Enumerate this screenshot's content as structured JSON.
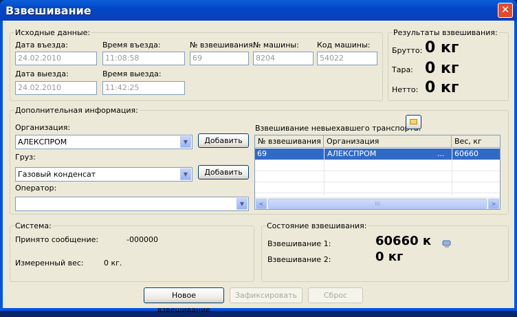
{
  "window": {
    "title": "Взвешивание",
    "close_glyph": "✕"
  },
  "source": {
    "legend": "Исходные данные:",
    "entry_date_label": "Дата въезда:",
    "entry_date": "24.02.2010",
    "entry_time_label": "Время въезда:",
    "entry_time": "11:08:58",
    "weighing_no_label": "№ взвешивания:",
    "weighing_no": "69",
    "car_no_label": "№ машины:",
    "car_no": "8204",
    "car_code_label": "Код машины:",
    "car_code": "54022",
    "exit_date_label": "Дата выезда:",
    "exit_date": "24.02.2010",
    "exit_time_label": "Время выезда:",
    "exit_time": "11:42:25"
  },
  "results": {
    "legend": "Результаты взвешивания:",
    "gross_label": "Брутто:",
    "gross": "0 кг",
    "tare_label": "Тара:",
    "tare": "0 кг",
    "net_label": "Нетто:",
    "net": "0 кг"
  },
  "extra": {
    "legend": "Дополнительная информация:",
    "org_label": "Организация:",
    "org_value": "АЛЕКСПРОМ",
    "cargo_label": "Груз:",
    "cargo_value": "Газовый конденсат",
    "operator_label": "Оператор:",
    "operator_value": "",
    "add_label": "Добавить",
    "pending_label": "Взвешивание невыехавшего транспорта:",
    "table": {
      "headers": [
        "№ взвешивания",
        "Организация",
        "Вес, кг"
      ],
      "rows": [
        [
          "69",
          "АЛЕКСПРОМ",
          "...",
          "60660"
        ]
      ]
    },
    "scroll_left": "<",
    "scroll_right": ">",
    "scroll_grip": "III",
    "combo_arrow": "▼"
  },
  "system": {
    "legend": "Система:",
    "msg_label": "Принято сообщение:",
    "msg_value": "-000000",
    "measured_label": "Измеренный вес:",
    "measured_value": "0 кг."
  },
  "state": {
    "legend": "Состояние взвешивания:",
    "w1_label": "Взвешивание 1:",
    "w1_value": "60660 к",
    "w2_label": "Взвешивание 2:",
    "w2_value": "0 кг"
  },
  "buttons": {
    "new": "Новое взвешивание",
    "fix": "Зафиксировать",
    "reset": "Сброс"
  }
}
